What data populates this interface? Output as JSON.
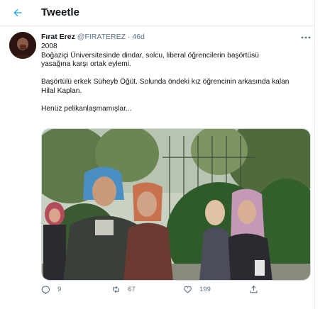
{
  "header": {
    "title": "Tweetle"
  },
  "icons": {
    "back": "arrow-left-icon",
    "more": "more-horizontal-icon",
    "reply": "reply-bubble-icon",
    "retweet": "retweet-icon",
    "like": "heart-icon",
    "share": "share-upload-icon"
  },
  "colors": {
    "accent": "#1da1f2",
    "muted": "#5b7083",
    "text": "#0f1419",
    "border": "#e6ecf0"
  },
  "tweet": {
    "author_name": "Fırat Erez",
    "handle": "@FIRATEREZ",
    "separator": "·",
    "age": "46d",
    "lines": [
      "2008",
      "Boğaziçi Üniversitesinde dindar, solcu, liberal öğrencilerin başörtüsü",
      "yasağına karşı ortak eylemi.",
      "",
      "Başörtülü erkek Süheyb Öğüt. Solunda öndeki kız öğrencinin arkasında kalan",
      "Hilal Kaplan.",
      "",
      "Henüz pelikanlaşmamışlar..."
    ]
  },
  "stats": {
    "replies": "9",
    "retweets": "67",
    "likes": "199"
  }
}
